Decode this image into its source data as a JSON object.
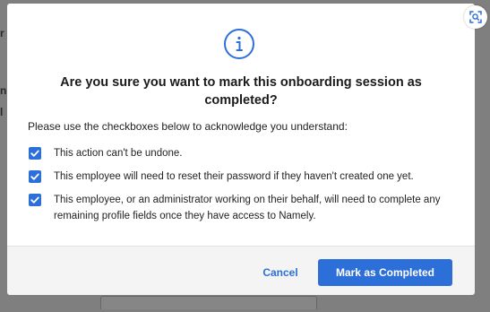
{
  "background": {
    "fragment_1": "r",
    "fragment_2": "n",
    "fragment_3": "l"
  },
  "modal": {
    "icon": "info-icon",
    "title": "Are you sure you want to mark this onboarding session as completed?",
    "instructions": "Please use the checkboxes below to acknowledge you understand:",
    "checkboxes": [
      {
        "label": "This action can't be undone.",
        "checked": true
      },
      {
        "label": "This employee will need to reset their password if they haven't created one yet.",
        "checked": true
      },
      {
        "label": "This employee, or an administrator working on their behalf, will need to complete any remaining profile fields once they have access to Namely.",
        "checked": true
      }
    ],
    "cancel_label": "Cancel",
    "confirm_label": "Mark as Completed"
  },
  "colors": {
    "accent": "#2d6fd9",
    "overlay": "#7f7f7f"
  },
  "overlay_icon": "scan-icon"
}
